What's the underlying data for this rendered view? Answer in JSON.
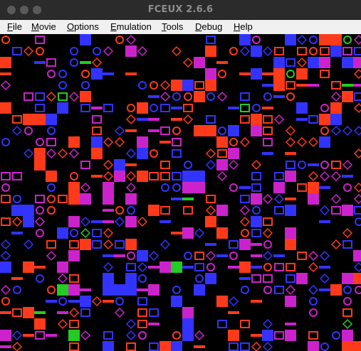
{
  "window": {
    "title": "FCEUX 2.6.6"
  },
  "menubar": {
    "items": [
      {
        "label": "File",
        "mnemonic": "F"
      },
      {
        "label": "Movie",
        "mnemonic": "M"
      },
      {
        "label": "Options",
        "mnemonic": "O"
      },
      {
        "label": "Emulation",
        "mnemonic": "E"
      },
      {
        "label": "Tools",
        "mnemonic": "T"
      },
      {
        "label": "Debug",
        "mnemonic": "D"
      },
      {
        "label": "Help",
        "mnemonic": "H"
      }
    ]
  },
  "screen": {
    "content": "corrupted-tile-pattern",
    "palette": [
      "#ff3a1a",
      "#3333ff",
      "#cc22cc",
      "#22cc22",
      "#000000"
    ]
  }
}
